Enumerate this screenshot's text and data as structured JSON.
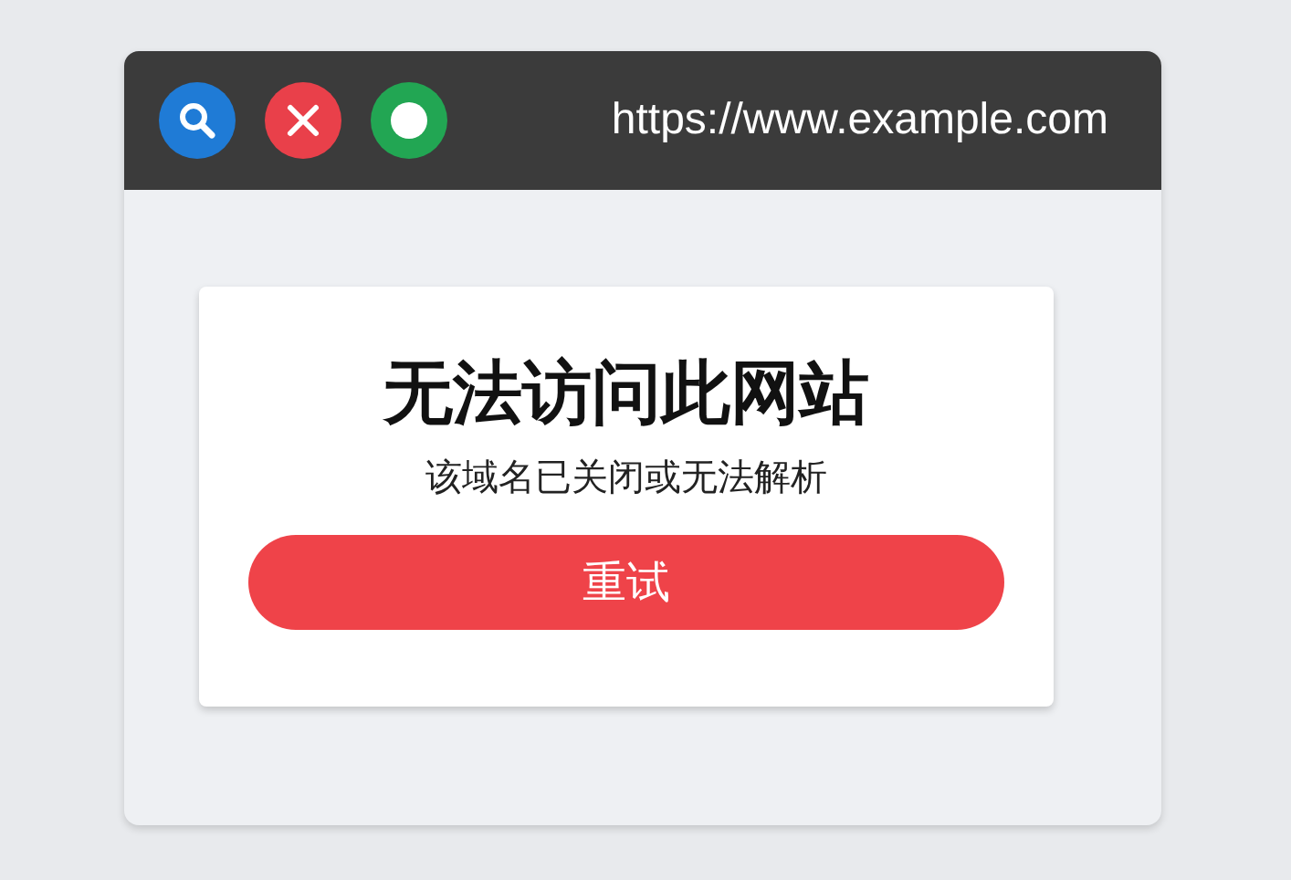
{
  "window": {
    "url": "https://www.example.com"
  },
  "error": {
    "title": "无法访问此网站",
    "message": "该域名已关闭或无法解析",
    "button": "重试"
  }
}
